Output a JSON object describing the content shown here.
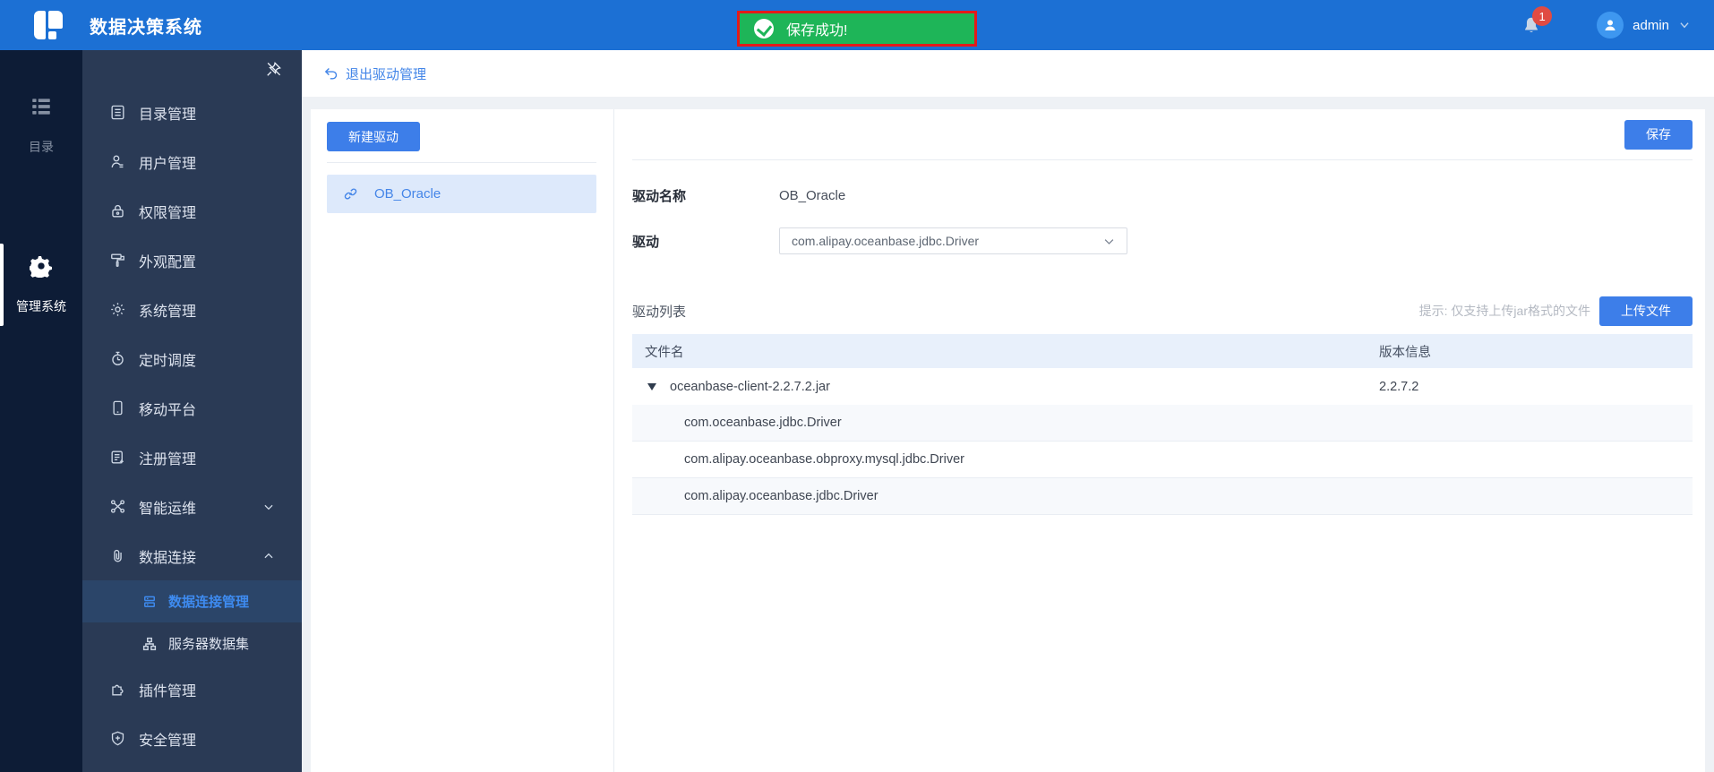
{
  "topbar": {
    "title": "数据决策系统",
    "toast_text": "保存成功!",
    "notification_count": "1",
    "username": "admin"
  },
  "rail": {
    "catalog_label": "目录",
    "manage_label": "管理系统"
  },
  "sidebar": {
    "menu": [
      {
        "label": "目录管理"
      },
      {
        "label": "用户管理"
      },
      {
        "label": "权限管理"
      },
      {
        "label": "外观配置"
      },
      {
        "label": "系统管理"
      },
      {
        "label": "定时调度"
      },
      {
        "label": "移动平台"
      },
      {
        "label": "注册管理"
      },
      {
        "label": "智能运维"
      },
      {
        "label": "数据连接"
      },
      {
        "label": "数据连接管理"
      },
      {
        "label": "服务器数据集"
      },
      {
        "label": "插件管理"
      },
      {
        "label": "安全管理"
      }
    ]
  },
  "content": {
    "exit_link": "退出驱动管理",
    "new_driver_button": "新建驱动",
    "selected_driver": "OB_Oracle",
    "save_button": "保存",
    "form": {
      "name_label": "驱动名称",
      "name_value": "OB_Oracle",
      "driver_label": "驱动",
      "driver_value": "com.alipay.oceanbase.jdbc.Driver",
      "list_label": "驱动列表",
      "upload_hint": "提示: 仅支持上传jar格式的文件",
      "upload_button": "上传文件"
    },
    "table": {
      "columns": [
        "文件名",
        "版本信息"
      ],
      "rows": [
        {
          "name": "oceanbase-client-2.2.7.2.jar",
          "version": "2.2.7.2"
        },
        {
          "name": "com.oceanbase.jdbc.Driver",
          "version": ""
        },
        {
          "name": "com.alipay.oceanbase.obproxy.mysql.jdbc.Driver",
          "version": ""
        },
        {
          "name": "com.alipay.oceanbase.jdbc.Driver",
          "version": ""
        }
      ]
    }
  },
  "colors": {
    "topbar_blue": "#1c70d4",
    "toast_green": "#1eb558",
    "toast_border_red": "#e41a1a",
    "primary_button_blue": "#3d7ee9",
    "sidebar_navy": "#2a3a55",
    "rail_navy": "#0d1c36",
    "active_link_blue": "#3e8bf0",
    "selected_item_bg": "#dde9fb",
    "table_header_bg": "#e8f0fb",
    "badge_red": "#e04b43"
  }
}
